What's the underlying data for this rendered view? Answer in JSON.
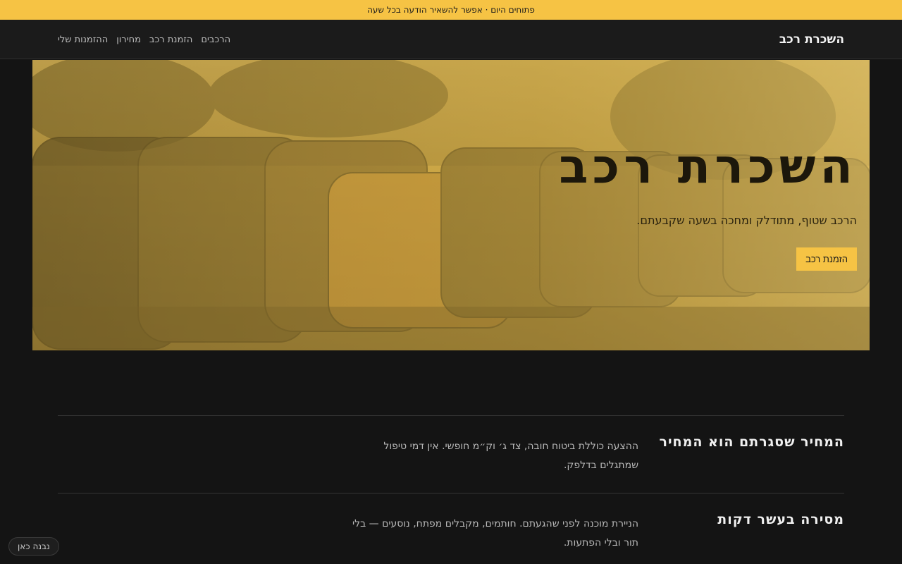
{
  "announcement": "פתוחים היום · אפשר להשאיר הודעה בכל שעה",
  "nav": {
    "brand": "השכרת רכב",
    "links": [
      "הרכבים",
      "הזמנת רכב",
      "מחירון",
      "ההזמנות שלי"
    ]
  },
  "hero": {
    "title": "השכרת רכב",
    "subtitle": "הרכב שטוף, מתודלק ומחכה בשעה שקבעתם.",
    "cta": "הזמנת רכב"
  },
  "features": [
    {
      "title": "המחיר שסגרתם הוא המחיר",
      "text": "ההצעה כוללת ביטוח חובה, צד ג׳ וק״מ חופשי. אין דמי טיפול שמתגלים בדלפק."
    },
    {
      "title": "מסירה בעשר דקות",
      "text": "הניירת מוכנה לפני שהגעתם. חותמים, מקבלים מפתח, נוסעים — בלי תור ובלי הפתעות."
    }
  ],
  "made_here": "נבנה כאן",
  "colors": {
    "accent": "#f6c344",
    "background": "#141414",
    "nav": "#1b1b1b"
  }
}
